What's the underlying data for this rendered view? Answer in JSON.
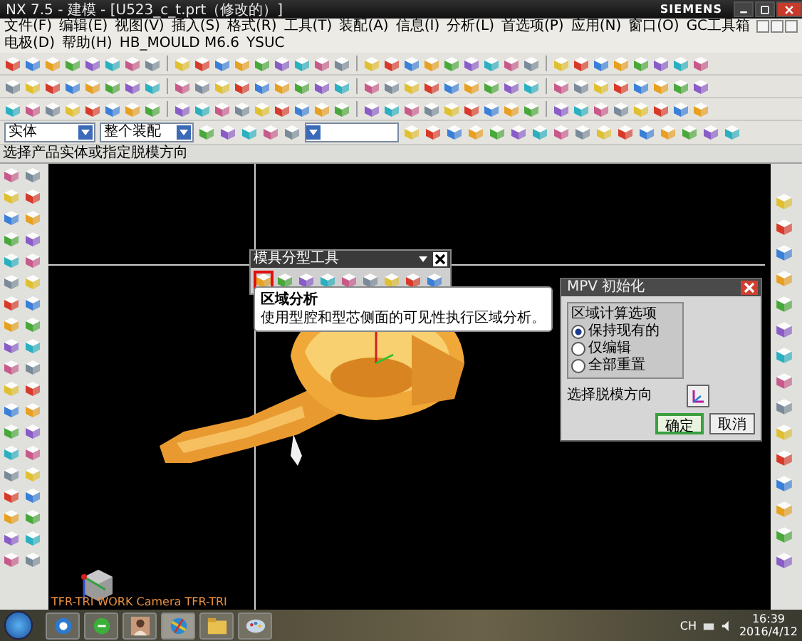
{
  "window": {
    "title": "NX 7.5 - 建模 - [U523_c_t.prt（修改的）]",
    "brand": "SIEMENS"
  },
  "menu": [
    "文件(F)",
    "编辑(E)",
    "视图(V)",
    "插入(S)",
    "格式(R)",
    "工具(T)",
    "装配(A)",
    "信息(I)",
    "分析(L)",
    "首选项(P)",
    "应用(N)",
    "窗口(O)",
    "GC工具箱",
    "电极(D)",
    "帮助(H)",
    "HB_MOULD M6.6",
    "YSUC"
  ],
  "selection_bar": {
    "filter": "实体",
    "scope": "整个装配"
  },
  "cue_line": "选择产品实体或指定脱模方向",
  "mold_toolbar": {
    "title": "模具分型工具",
    "tools": [
      {
        "selected": true
      },
      {
        "selected": false
      },
      {
        "selected": false
      },
      {
        "selected": false
      },
      {
        "selected": false
      },
      {
        "selected": false
      },
      {
        "selected": false
      },
      {
        "selected": false
      },
      {
        "selected": false
      }
    ]
  },
  "tooltip": {
    "title": "区域分析",
    "text": "使用型腔和型芯侧面的可见性执行区域分析。"
  },
  "mpv_dialog": {
    "title": "MPV 初始化",
    "group": "区域计算选项",
    "options": [
      {
        "label": "保持现有的",
        "selected": true
      },
      {
        "label": "仅编辑",
        "selected": false
      },
      {
        "label": "全部重置",
        "selected": false
      }
    ],
    "direction_label": "选择脱模方向",
    "buttons": [
      {
        "label": "确定",
        "kind": "default"
      },
      {
        "label": "取消",
        "kind": "normal"
      }
    ]
  },
  "view_label": "TFR-TRI WORK Camera TFR-TRI",
  "taskbar": {
    "language": "CH",
    "time": "16:39",
    "date": "2016/4/12"
  }
}
